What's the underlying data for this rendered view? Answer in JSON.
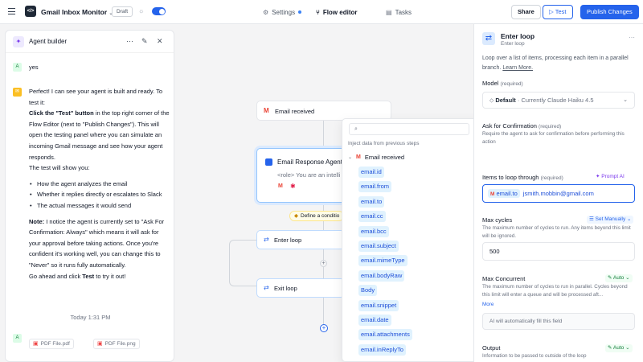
{
  "topbar": {
    "app_title": "Gmail Inbox Monitor",
    "draft_badge": "Draft",
    "tabs": [
      {
        "label": "Settings",
        "has_dot": true
      },
      {
        "label": "Flow editor",
        "active": true
      },
      {
        "label": "Tasks"
      }
    ],
    "share_label": "Share",
    "test_label": "Test",
    "publish_label": "Publish Changes"
  },
  "chat": {
    "title": "Agent builder",
    "user_avatar": "A",
    "user_msg": "yes",
    "reply": {
      "p1": "Perfect! I can see your agent is built and ready. To test it:",
      "bold1": "Click the \"Test\" button",
      "p2": " in the top right corner of the Flow Editor (next to \"Publish Changes\"). This will open the testing panel where you can simulate an incoming Gmail message and see how your agent responds.",
      "p3": "The test will show you:",
      "bullets": [
        "How the agent analyzes the email",
        "Whether it replies directly or escalates to Slack",
        "The actual messages it would send"
      ],
      "note_label": "Note:",
      "note_text": " I notice the agent is currently set to \"Ask For Confirmation: Always\" which means it will ask for your approval before taking actions. Once you're confident it's working well, you can change this to \"Never\" so it runs fully automatically.",
      "p4a": "Go ahead and click ",
      "p4b": "Test",
      "p4c": " to try it out!"
    },
    "timestamp": "Today 1:31 PM",
    "attachments": [
      "PDF File.pdf",
      "PDF File.png"
    ]
  },
  "canvas": {
    "trigger": "Email received",
    "agent_title": "Email Response Agent",
    "agent_prompt": "<role> You are an intelli",
    "condition": "Define a conditio",
    "enter_loop": "Enter loop",
    "exit_loop": "Exit loop"
  },
  "dropdown": {
    "hint": "Inject data from previous steps",
    "group": "Email received",
    "fields": [
      "email.id",
      "email.from",
      "email.to",
      "email.cc",
      "email.bcc",
      "email.subject",
      "email.mimeType",
      "email.bodyRaw",
      "Body",
      "email.snippet",
      "email.date",
      "email.attachments",
      "email.inReplyTo"
    ]
  },
  "panel": {
    "title": "Enter loop",
    "subtitle": "Enter loop",
    "desc": "Loop over a list of items, processing each item in a parallel branch.",
    "learn_more": "Learn More.",
    "model_label": "Model",
    "model_req": "(required)",
    "model_default": "Default",
    "model_value": "· Currently Claude Haiku 4.5",
    "ask_label": "Ask for Confirmation",
    "ask_req": "(required)",
    "ask_desc": "Require the agent to ask for confirmation before performing this action",
    "items_label": "Items to loop through",
    "items_req": "(required)",
    "items_mode": "Prompt AI",
    "items_chip": "email.to",
    "items_value": "jsmith.mobbin@gmail.com",
    "maxc_label": "Max cycles",
    "maxc_mode": "Set Manually",
    "maxc_desc": "The maximum number of cycles to run. Any items beyond this limit will be ignored.",
    "maxc_value": "500",
    "conc_label": "Max Concurrent",
    "conc_mode": "Auto",
    "conc_desc": "The maximum number of cycles to run in parallel. Cycles beyond this limit will enter a queue and will be processed aft...",
    "more": "More",
    "conc_auto_text": "AI will automatically fill this field",
    "out_label": "Output",
    "out_mode": "Auto",
    "out_desc": "Information to be passed to outside of the loop"
  },
  "colors": {
    "accent": "#2563eb",
    "purple": "#7c3aed",
    "green": "#15803d"
  }
}
